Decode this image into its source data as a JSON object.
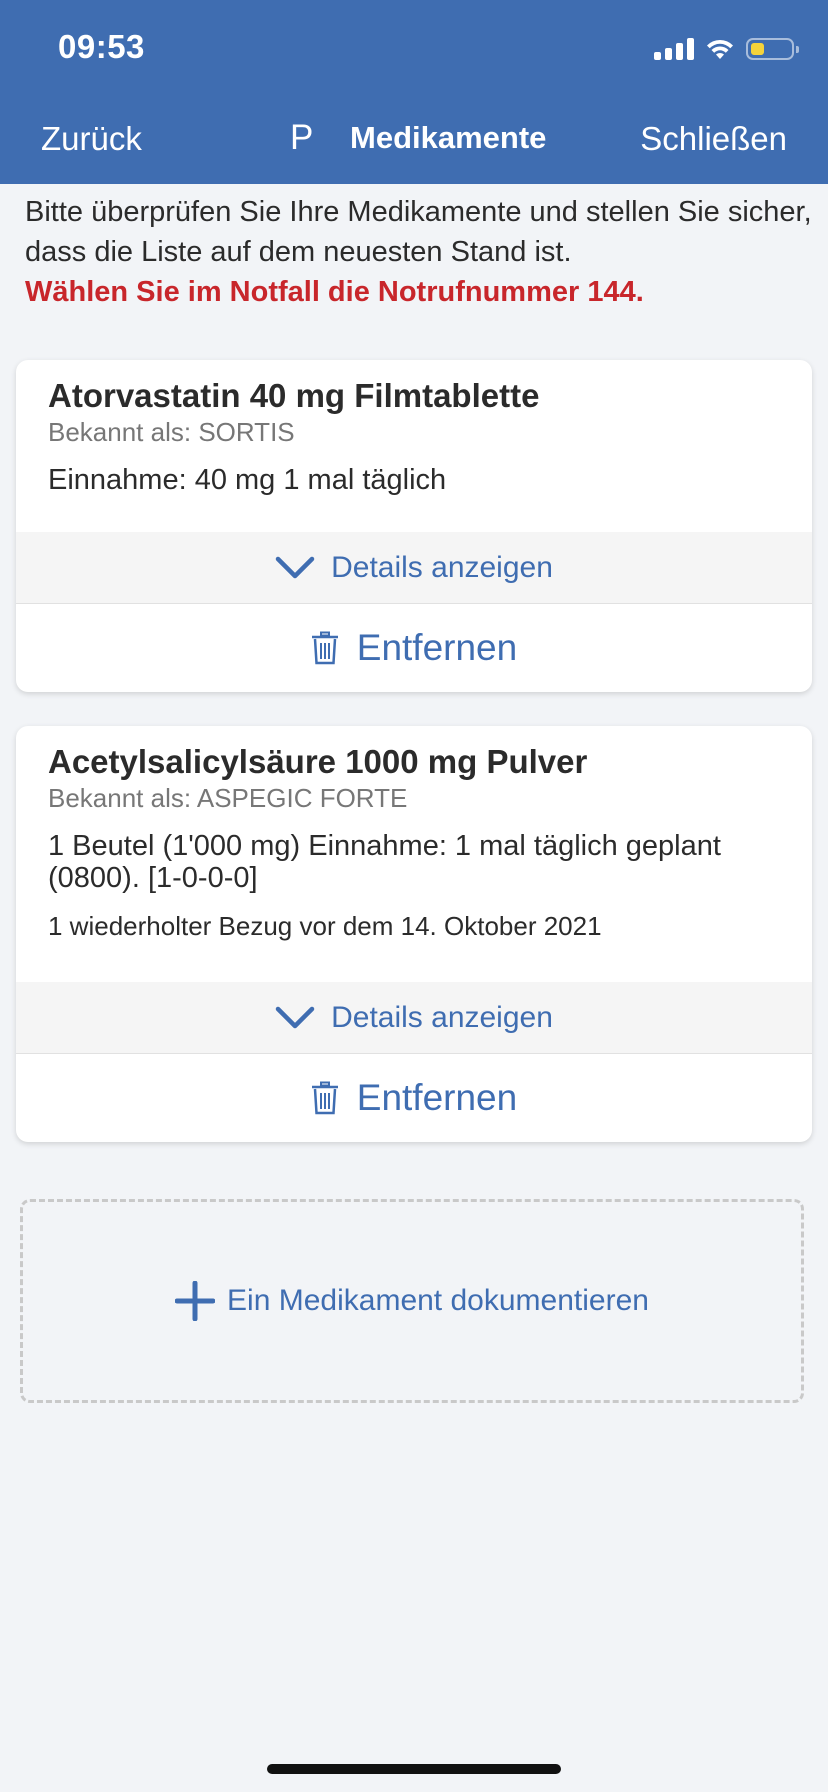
{
  "status_bar": {
    "time": "09:53"
  },
  "nav": {
    "back_label": "Zurück",
    "avatar_letter": "P",
    "title": "Medikamente",
    "close_label": "Schließen"
  },
  "intro": {
    "text": "Bitte überprüfen Sie Ihre Medikamente und stellen Sie sicher, dass die Liste auf dem neuesten Stand ist.",
    "warning": "Wählen Sie im Notfall die Notrufnummer 144."
  },
  "medications": [
    {
      "name": "Atorvastatin 40 mg Filmtablette",
      "known_as": "Bekannt als: SORTIS",
      "dosage": "Einnahme: 40 mg 1 mal täglich",
      "details_label": "Details anzeigen",
      "remove_label": "Entfernen"
    },
    {
      "name": "Acetylsalicylsäure 1000 mg Pulver",
      "known_as": "Bekannt als: ASPEGIC FORTE",
      "dosage": "1 Beutel (1'000 mg) Einnahme: 1 mal täglich geplant (0800). [1-0-0-0]",
      "refill": "1 wiederholter Bezug vor dem 14. Oktober 2021",
      "details_label": "Details anzeigen",
      "remove_label": "Entfernen"
    }
  ],
  "add_medication": {
    "label": "Ein Medikament dokumentieren"
  },
  "colors": {
    "header": "#3f6db1",
    "accent": "#3f6db1",
    "warning": "#c8262b",
    "background": "#f2f4f7"
  },
  "icons": [
    "wifi-icon",
    "signal-icon",
    "battery-icon",
    "chevron-down-icon",
    "trash-icon",
    "plus-icon"
  ]
}
